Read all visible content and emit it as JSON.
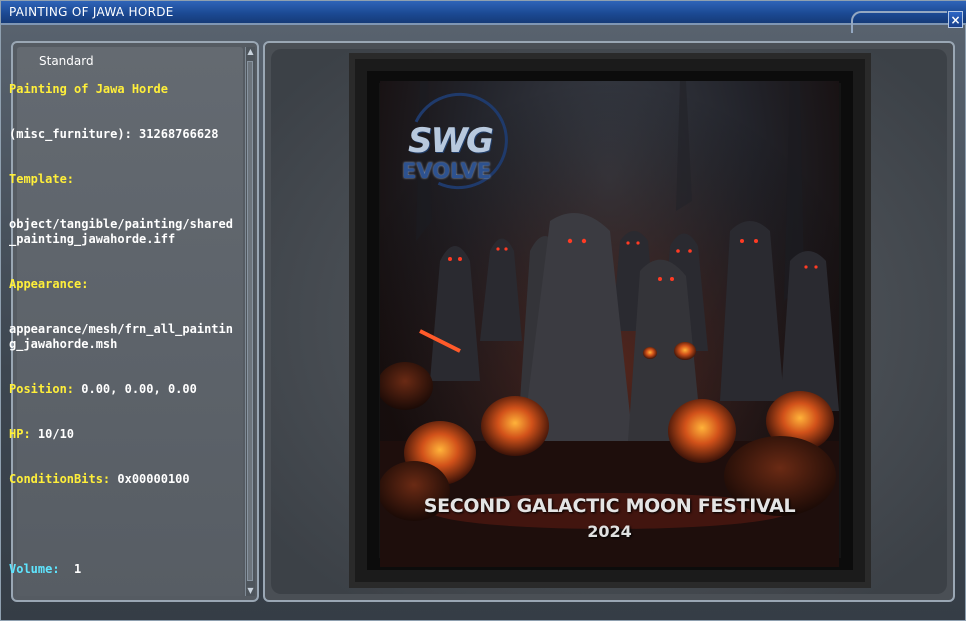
{
  "window": {
    "title": "PAINTING OF JAWA HORDE",
    "close_glyph": "×"
  },
  "left_panel": {
    "header": "Standard",
    "info": {
      "name": "Painting of Jawa Horde",
      "object_id": "(misc_furniture): 31268766628",
      "template_label": "Template:",
      "template_value": "object/tangible/painting/shared_painting_jawahorde.iff",
      "appearance_label": "Appearance:",
      "appearance_value": "appearance/mesh/frn_all_painting_jawahorde.msh",
      "position_label": "Position:",
      "position_value": " 0.00, 0.00, 0.00",
      "hp_label": "HP:",
      "hp_value": " 10/10",
      "condition_label": "ConditionBits:",
      "condition_value": " 0x00000100",
      "volume_label": "Volume:",
      "volume_value": "  1"
    }
  },
  "painting": {
    "logo_top": "SWG",
    "logo_bottom": "EVOLVE",
    "title": "SECOND GALACTIC MOON FESTIVAL",
    "year": "2024"
  },
  "colors": {
    "label_yellow": "#ffef3a",
    "label_cyan": "#5fe6ff",
    "title_bar": "#1c4a94"
  },
  "icons": {
    "close": "close-icon",
    "scroll_up": "scroll-up-arrow-icon",
    "scroll_down": "scroll-down-arrow-icon"
  }
}
